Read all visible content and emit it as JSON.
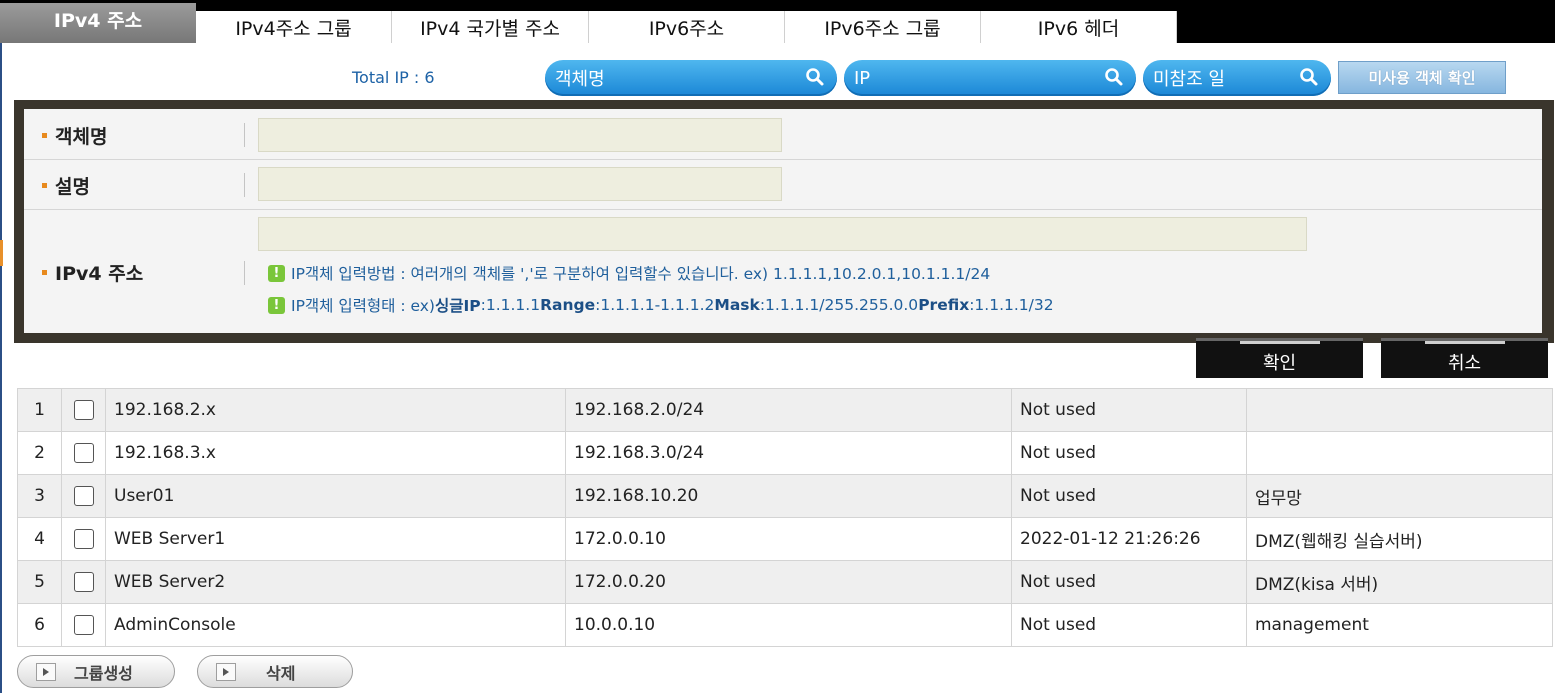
{
  "tabs": [
    {
      "label": "IPv4 주소",
      "active": true
    },
    {
      "label": "IPv4주소 그룹",
      "active": false
    },
    {
      "label": "IPv4 국가별 주소",
      "active": false
    },
    {
      "label": "IPv6주소",
      "active": false
    },
    {
      "label": "IPv6주소 그룹",
      "active": false
    },
    {
      "label": "IPv6 헤더",
      "active": false
    }
  ],
  "toolbar": {
    "total": "Total IP : 6",
    "search_name": "객체명",
    "search_ip": "IP",
    "search_unref": "미참조 일",
    "unused_button": "미사용 객체 확인"
  },
  "form": {
    "name_label": "객체명",
    "desc_label": "설명",
    "ipv4_label": "IPv4 주소",
    "name_value": "",
    "desc_value": "",
    "ipv4_value": "",
    "hint1": "IP객체 입력방법 : 여러개의 객체를 ','로 구분하여 입력할수 있습니다. ex) 1.1.1.1,10.2.0.1,10.1.1.1/24",
    "hint2_pre": "IP객체 입력형태 : ex) ",
    "hint2_single": "싱글IP",
    "hint2_single_val": ":1.1.1.1 ",
    "hint2_range": "Range",
    "hint2_range_val": ":1.1.1.1-1.1.1.2 ",
    "hint2_mask": "Mask",
    "hint2_mask_val": ":1.1.1.1/255.255.0.0 ",
    "hint2_prefix": "Prefix",
    "hint2_prefix_val": ":1.1.1.1/32",
    "confirm": "확인",
    "cancel": "취소"
  },
  "rows": [
    {
      "num": "1",
      "name": "192.168.2.x",
      "ip": "192.168.2.0/24",
      "last": "Not used",
      "desc": ""
    },
    {
      "num": "2",
      "name": "192.168.3.x",
      "ip": "192.168.3.0/24",
      "last": "Not used",
      "desc": ""
    },
    {
      "num": "3",
      "name": "User01",
      "ip": "192.168.10.20",
      "last": "Not used",
      "desc": "업무망"
    },
    {
      "num": "4",
      "name": "WEB Server1",
      "ip": "172.0.0.10",
      "last": "2022-01-12 21:26:26",
      "desc": "DMZ(웹해킹 실습서버)"
    },
    {
      "num": "5",
      "name": "WEB Server2",
      "ip": "172.0.0.20",
      "last": "Not used",
      "desc": "DMZ(kisa 서버)"
    },
    {
      "num": "6",
      "name": "AdminConsole",
      "ip": "10.0.0.10",
      "last": "Not used",
      "desc": "management"
    }
  ],
  "bottom": {
    "group_create": "그룹생성",
    "delete": "삭제"
  },
  "colors": {
    "accent_blue": "#1a86d6",
    "tab_active": "#8a8a8a",
    "panel_frame": "#3a352c",
    "bullet": "#e88a1e",
    "hint_icon": "#7ac63a"
  }
}
